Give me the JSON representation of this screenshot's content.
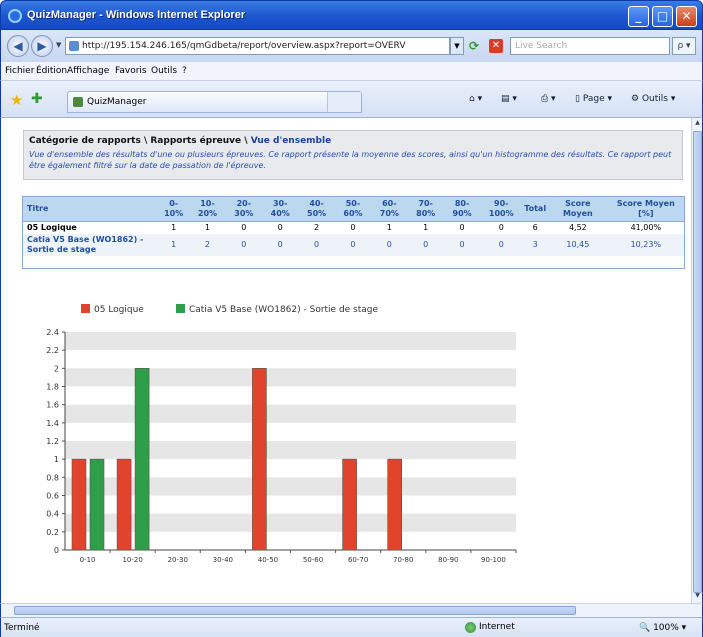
{
  "window": {
    "title": "QuizManager - Windows Internet Explorer",
    "minimize": "_",
    "maximize": "□",
    "close": "✕"
  },
  "address": {
    "url": "http://195.154.246.165/qmGdbeta/report/overview.aspx?report=OVERV",
    "search_placeholder": "Live Search",
    "search_glyph": "ρ ▾"
  },
  "menu": [
    "Fichier",
    "Édition",
    "Affichage",
    "Favoris",
    "Outils",
    "?"
  ],
  "tab": {
    "label": "QuizManager"
  },
  "commands": {
    "page": "Page",
    "tools": "Outils"
  },
  "report": {
    "breadcrumb_part1": "Catégorie de rapports \\ Rapports épreuve \\ ",
    "breadcrumb_active": "Vue d'ensemble",
    "description": "Vue d'ensemble des résultats d'une ou plusieurs épreuves. Ce rapport présente la moyenne des scores, ainsi qu'un histogramme des résultats. Ce rapport peut être également filtré sur la date de passation de l'épreuve.",
    "columns": [
      "Titre",
      "0-10%",
      "10-20%",
      "20-30%",
      "30-40%",
      "40-50%",
      "50-60%",
      "60-70%",
      "70-80%",
      "80-90%",
      "90-100%",
      "Total",
      "Score Moyen",
      "Score Moyen [%]"
    ],
    "rows": [
      {
        "title": "05 Logique",
        "cells": [
          "1",
          "1",
          "0",
          "0",
          "2",
          "0",
          "1",
          "1",
          "0",
          "0",
          "6",
          "4,52",
          "41,00%"
        ]
      },
      {
        "title": "Catia V5 Base (WO1862) - Sortie de stage",
        "cells": [
          "1",
          "2",
          "0",
          "0",
          "0",
          "0",
          "0",
          "0",
          "0",
          "0",
          "3",
          "10,45",
          "10,23%"
        ]
      }
    ]
  },
  "chart_data": {
    "type": "bar",
    "categories": [
      "0-10",
      "10-20",
      "20-30",
      "30-40",
      "40-50",
      "50-60",
      "60-70",
      "70-80",
      "80-90",
      "90-100"
    ],
    "series": [
      {
        "name": "05 Logique",
        "color": "#e0442c",
        "values": [
          1,
          1,
          0,
          0,
          2,
          0,
          1,
          1,
          0,
          0
        ]
      },
      {
        "name": "Catia V5 Base (WO1862) - Sortie de stage",
        "color": "#2f9e48",
        "values": [
          1,
          2,
          0,
          0,
          0,
          0,
          0,
          0,
          0,
          0
        ]
      }
    ],
    "yticks": [
      "0",
      "0.2",
      "0.4",
      "0.6",
      "0.8",
      "1",
      "1.2",
      "1.4",
      "1.6",
      "1.8",
      "2",
      "2.2",
      "2.4"
    ],
    "ylim": [
      0,
      2.4
    ],
    "legend": "top",
    "grid": true
  },
  "status": {
    "text": "Terminé",
    "zone": "Internet",
    "zoom": "100%"
  }
}
